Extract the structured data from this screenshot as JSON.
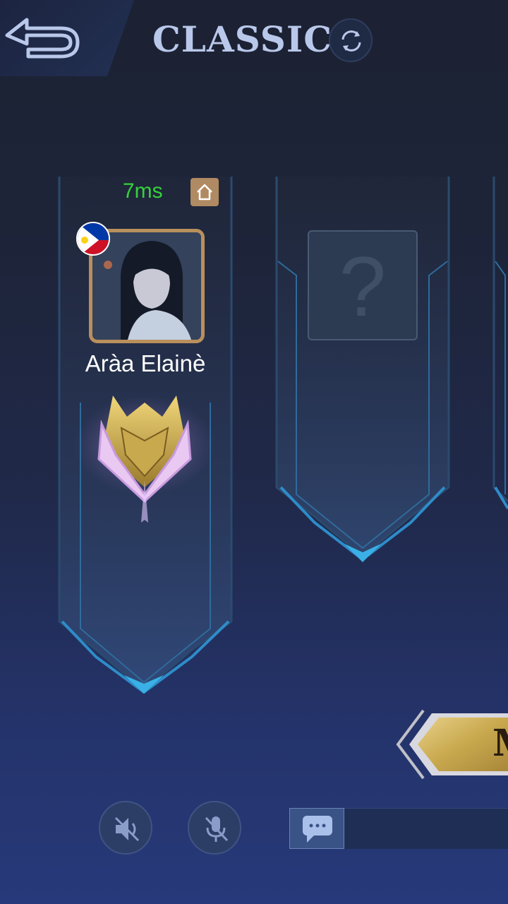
{
  "header": {
    "mode_title": "CLASSIC",
    "back_icon": "back-arrow-icon",
    "refresh_icon": "refresh-icon"
  },
  "lobby": {
    "slots": [
      {
        "ping": "7ms",
        "home_icon": "home-icon",
        "flag": "philippines-flag",
        "player_name": "Aràa Elainè",
        "rank_icon": "gold-rank-emblem-icon"
      },
      {
        "empty_placeholder": "?"
      }
    ]
  },
  "match_button": {
    "label": "M"
  },
  "controls": {
    "speaker_icon": "speaker-muted-icon",
    "mic_icon": "mic-muted-icon",
    "chat_icon": "chat-bubble-icon"
  },
  "colors": {
    "ping_green": "#35d23b",
    "banner_border": "#2e8cc8",
    "gold": "#c9a94e",
    "title": "#b9c8ea"
  }
}
